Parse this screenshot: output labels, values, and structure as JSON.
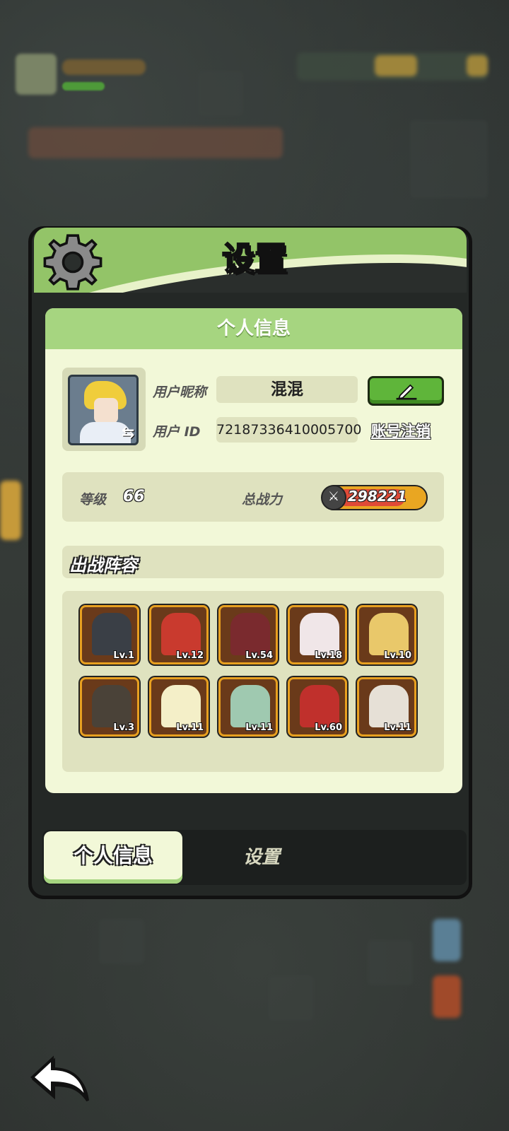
{
  "header": {
    "title": "设置"
  },
  "personal_info": {
    "section_title": "个人信息",
    "nickname_label": "用户昵称",
    "nickname_value": "混混",
    "id_label": "用户  ID",
    "id_value": "72187336410005700",
    "delete_account_label": "账号注销",
    "level_label": "等级",
    "level_value": "66",
    "power_label": "总战力",
    "power_value": "298221"
  },
  "lineup": {
    "title": "出战阵容",
    "heroes": [
      {
        "level": "Lv.1",
        "color": "#3a3f46"
      },
      {
        "level": "Lv.12",
        "color": "#c93a2e"
      },
      {
        "level": "Lv.54",
        "color": "#7a2a2e"
      },
      {
        "level": "Lv.18",
        "color": "#f0e6e8"
      },
      {
        "level": "Lv.10",
        "color": "#e9c86a"
      },
      {
        "level": "Lv.3",
        "color": "#4a4238"
      },
      {
        "level": "Lv.11",
        "color": "#f4efc8"
      },
      {
        "level": "Lv.11",
        "color": "#9fc9b0"
      },
      {
        "level": "Lv.60",
        "color": "#c0302c"
      },
      {
        "level": "Lv.11",
        "color": "#e6e0d6"
      }
    ]
  },
  "tabs": {
    "active": "个人信息",
    "inactive": "设置"
  }
}
